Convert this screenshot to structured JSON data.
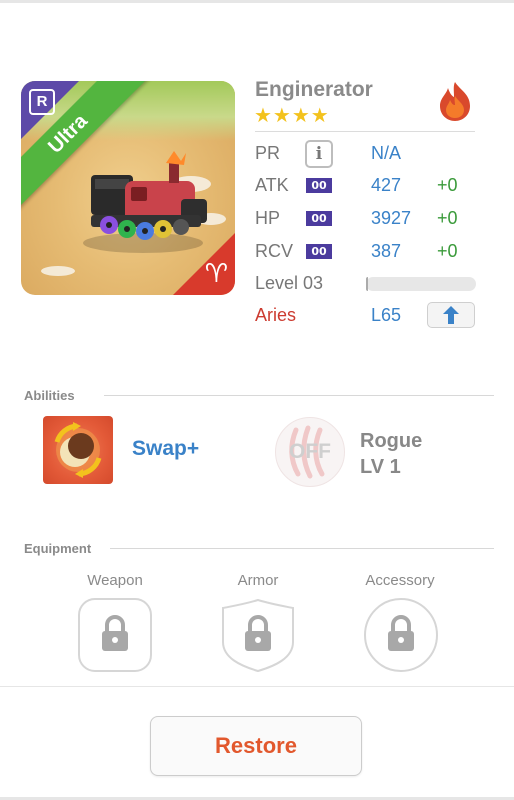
{
  "monster": {
    "name": "Enginerator",
    "stars": "★★★★",
    "rarity": "Ultra",
    "rank_badge": "R",
    "zodiac_symbol": "♈",
    "element_icon": "fire-element-icon"
  },
  "stats": {
    "pr": {
      "label": "PR",
      "value": "N/A",
      "icon": "info-icon"
    },
    "atk": {
      "label": "ATK",
      "tag": "00",
      "value": "427",
      "bonus": "+0"
    },
    "hp": {
      "label": "HP",
      "tag": "00",
      "value": "3927",
      "bonus": "+0"
    },
    "rcv": {
      "label": "RCV",
      "tag": "00",
      "value": "387",
      "bonus": "+0"
    },
    "level": {
      "label": "Level 03",
      "progress": 0.02
    },
    "zodiac": {
      "label": "Aries",
      "value": "L65"
    }
  },
  "abilities": {
    "title": "Abilities",
    "skill": {
      "name": "Swap+",
      "icon": "swap-skill-icon"
    },
    "awaken": {
      "state": "OFF",
      "name_line1": "Rogue",
      "name_line2": "LV 1",
      "icon": "claw-icon"
    }
  },
  "equipment": {
    "title": "Equipment",
    "slots": [
      {
        "label": "Weapon",
        "icon": "lock-icon"
      },
      {
        "label": "Armor",
        "icon": "lock-icon"
      },
      {
        "label": "Accessory",
        "icon": "lock-icon"
      }
    ]
  },
  "footer": {
    "restore_label": "Restore"
  },
  "colors": {
    "accent_blue": "#3a82c8",
    "bonus_green": "#3a9a3a",
    "aries_red": "#cc3b30",
    "restore_orange": "#e2582d",
    "ultra_green": "#53b53f",
    "rank_purple": "#5d4aa8"
  }
}
